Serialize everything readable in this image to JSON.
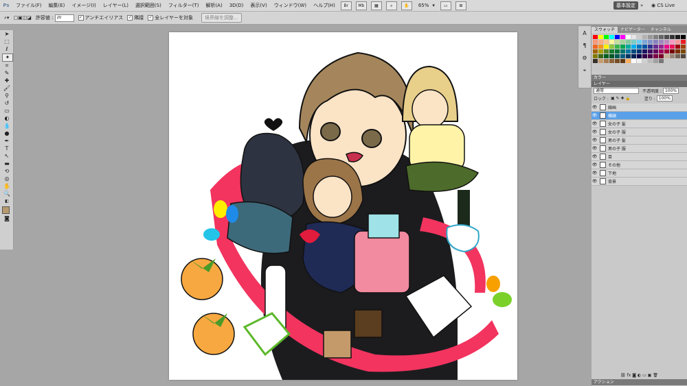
{
  "app": {
    "logo": "Ps"
  },
  "menu": [
    "ファイル(F)",
    "編集(E)",
    "イメージ(I)",
    "レイヤー(L)",
    "選択範囲(S)",
    "フィルター(T)",
    "解析(A)",
    "3D(D)",
    "表示(V)",
    "ウィンドウ(W)",
    "ヘルプ(H)"
  ],
  "menu_icons": {
    "br": "Br",
    "mb": "Mb"
  },
  "zoom_label": "65%",
  "workspace_button": "基本設定",
  "cs_live": "CS Live",
  "options": {
    "tolerance_label": "許容値 :",
    "tolerance_value": "20",
    "antialias_label": "アンチエイリアス",
    "contiguous_label": "隣接",
    "sample_all_label": "全レイヤーを対象",
    "refine_edge_label": "境界線を調整..."
  },
  "panels": {
    "color_tabs": [
      "スウォッチ",
      "ナビゲーター",
      "チャンネル"
    ],
    "color_panel_title": "カラー",
    "layers_title": "レイヤー",
    "blend_mode": "通常",
    "opacity_label": "不透明度 :",
    "opacity_value": "100%",
    "lock_label": "ロック :",
    "fill_label": "塗り :",
    "fill_value": "100%",
    "actions_title": "アクション",
    "layers": [
      {
        "name": "線画",
        "selected": false
      },
      {
        "name": "横縞",
        "selected": true
      },
      {
        "name": "女の子 髪",
        "selected": false
      },
      {
        "name": "女の子 服",
        "selected": false
      },
      {
        "name": "男の子 髪",
        "selected": false
      },
      {
        "name": "男の子 服",
        "selected": false
      },
      {
        "name": "目",
        "selected": false
      },
      {
        "name": "その他",
        "selected": false
      },
      {
        "name": "下地",
        "selected": false
      },
      {
        "name": "背景",
        "selected": false
      }
    ]
  },
  "swatch_colors": [
    "#ff0000",
    "#ffff00",
    "#00ff00",
    "#00ffff",
    "#0000ff",
    "#ff00ff",
    "#ffffff",
    "#e6e6e6",
    "#cccccc",
    "#b3b3b3",
    "#999999",
    "#808080",
    "#666666",
    "#4d4d4d",
    "#333333",
    "#1a1a1a",
    "#000000",
    "#f7977a",
    "#f9ad81",
    "#fdc68a",
    "#fff79a",
    "#c4df9b",
    "#a3d39c",
    "#82ca9d",
    "#7bcdc8",
    "#6ecff6",
    "#7ea7d8",
    "#8493ca",
    "#8882be",
    "#a187be",
    "#bc8dbf",
    "#f49ac2",
    "#f6989d",
    "#ed1c24",
    "#f26522",
    "#f7941d",
    "#fff200",
    "#8dc63f",
    "#39b54a",
    "#00a651",
    "#00a99d",
    "#00aeef",
    "#0072bc",
    "#0054a6",
    "#2e3192",
    "#662d91",
    "#92278f",
    "#ec008c",
    "#ed145b",
    "#9e0b0f",
    "#a0410d",
    "#a36209",
    "#aba000",
    "#598527",
    "#1a7b30",
    "#007236",
    "#00746b",
    "#0076a3",
    "#004b80",
    "#003471",
    "#1b1464",
    "#440e62",
    "#630460",
    "#9e005d",
    "#9e0039",
    "#790000",
    "#7b2e00",
    "#7d4900",
    "#827b00",
    "#406618",
    "#005e20",
    "#005826",
    "#005952",
    "#005b7f",
    "#003663",
    "#002157",
    "#0d004c",
    "#32004b",
    "#4b0049",
    "#7b0046",
    "#7a0026",
    "#c7b299",
    "#998675",
    "#736357",
    "#534741",
    "#37302a",
    "#c69c6d",
    "#a67c52",
    "#8c6239",
    "#754c24",
    "#603913",
    "#fbaf5d",
    "#f8f8f8",
    "#eeeeee",
    "#d0d0d0",
    "#bbbbbb",
    "#a0a0a0",
    "#777777"
  ]
}
